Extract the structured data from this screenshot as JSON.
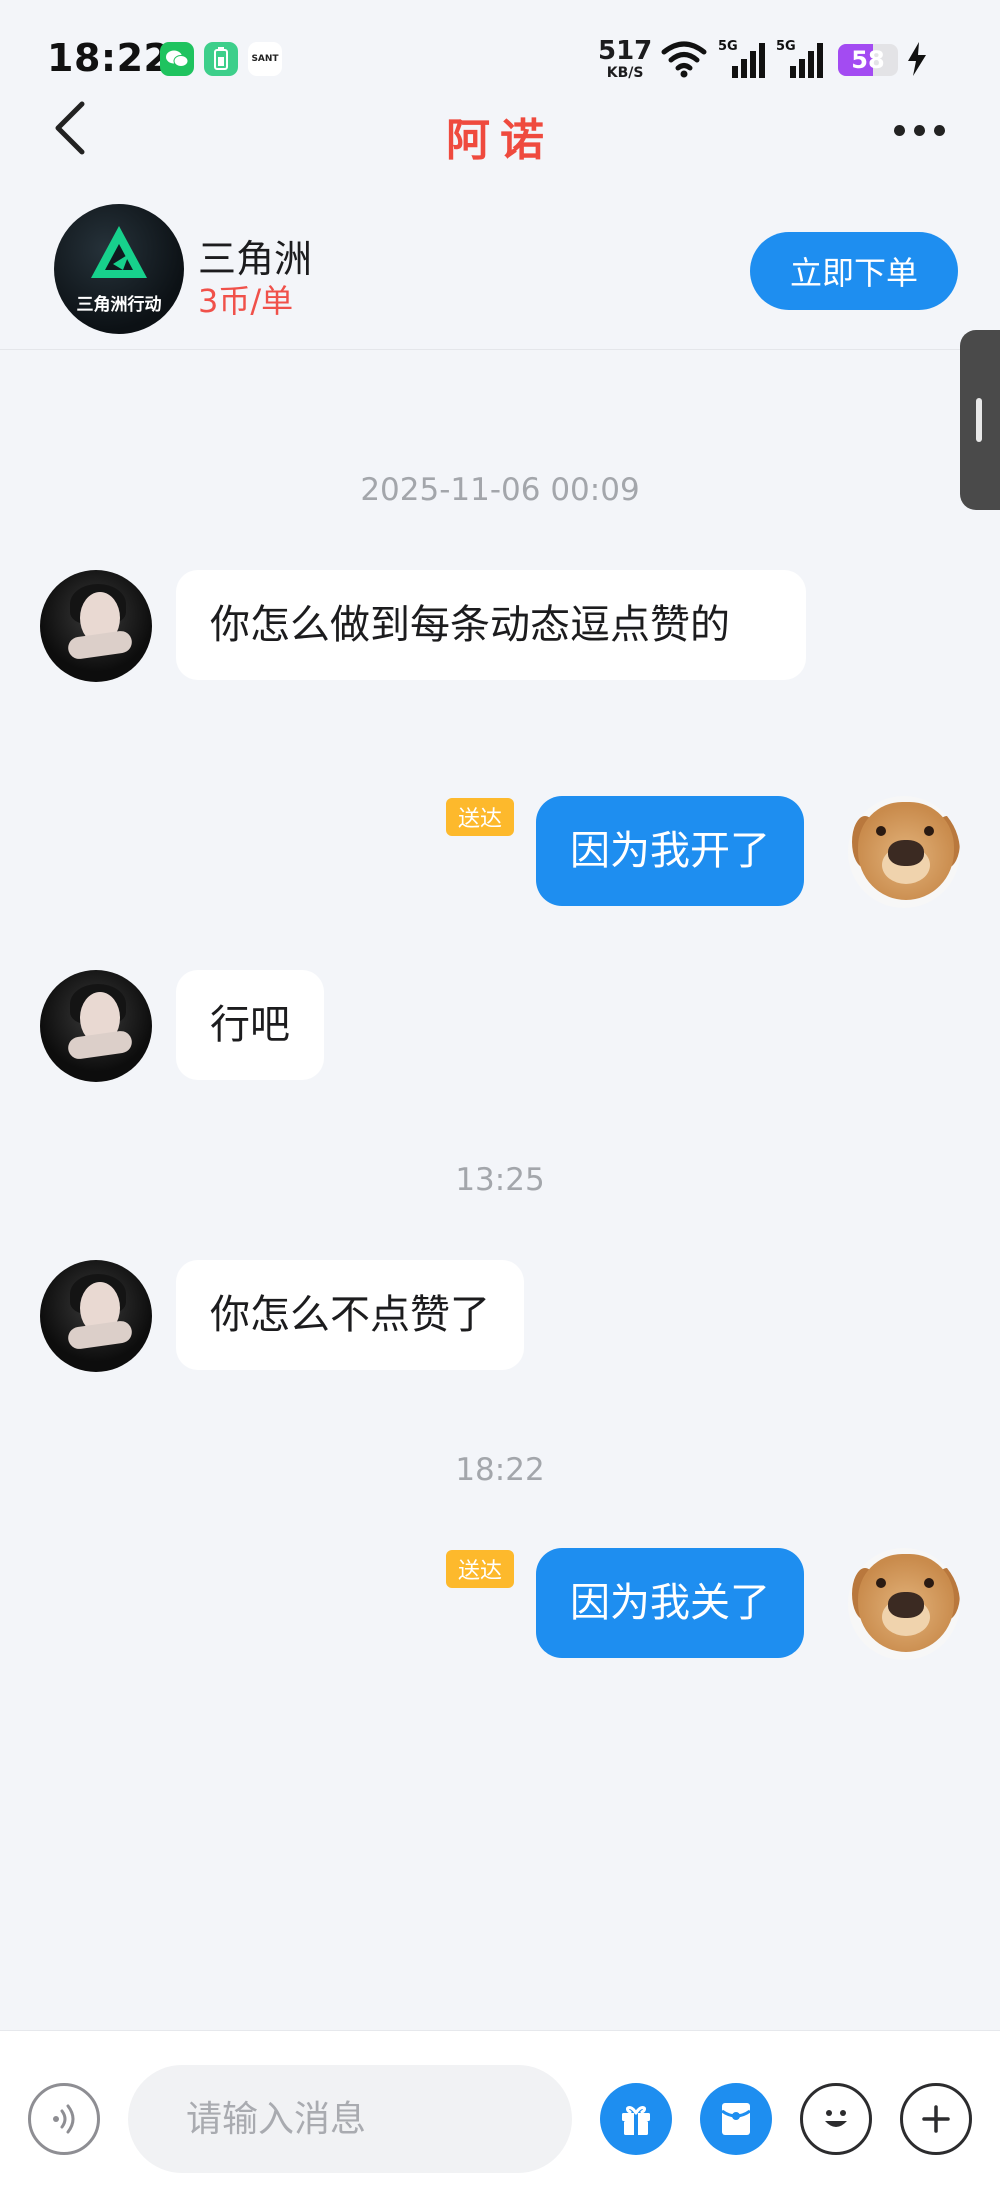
{
  "status_bar": {
    "time": "18:22",
    "net_speed_value": "517",
    "net_speed_unit": "KB/S",
    "signal1_label": "5G",
    "signal2_label": "5G",
    "battery_level": "58",
    "battery_fraction": 0.58,
    "sant_label": "SANT",
    "icons": [
      "wechat-icon",
      "battery-app-icon",
      "sant-app-icon",
      "wifi-icon",
      "signal-5g-icon",
      "signal-5g-icon",
      "battery-icon",
      "charging-icon"
    ]
  },
  "header": {
    "title": "阿诺",
    "back_icon": "chevron-left-icon",
    "more_icon": "more-dots-icon"
  },
  "product": {
    "logo_text": "三角洲行动",
    "name": "三角洲",
    "price": "3币/单",
    "order_button": "立即下单"
  },
  "colors": {
    "title_red": "#ef4a3e",
    "accent_blue": "#1e8ef0",
    "price_red": "#f0514a",
    "delivered_badge": "#fdb92c",
    "background": "#f3f5f9"
  },
  "chat": {
    "timestamps": [
      "2025-11-06 00:09",
      "13:25",
      "18:22"
    ],
    "messages": [
      {
        "from": "other",
        "text": "你怎么做到每条动态逗点赞的"
      },
      {
        "from": "me",
        "text": "因为我开了",
        "status": "送达"
      },
      {
        "from": "other",
        "text": "行吧"
      },
      {
        "from": "other",
        "text": "你怎么不点赞了"
      },
      {
        "from": "me",
        "text": "因为我关了",
        "status": "送达"
      }
    ]
  },
  "input_bar": {
    "placeholder": "请输入消息",
    "icons": [
      "voice-icon",
      "gift-icon",
      "red-packet-icon",
      "emoji-icon",
      "plus-icon"
    ]
  }
}
